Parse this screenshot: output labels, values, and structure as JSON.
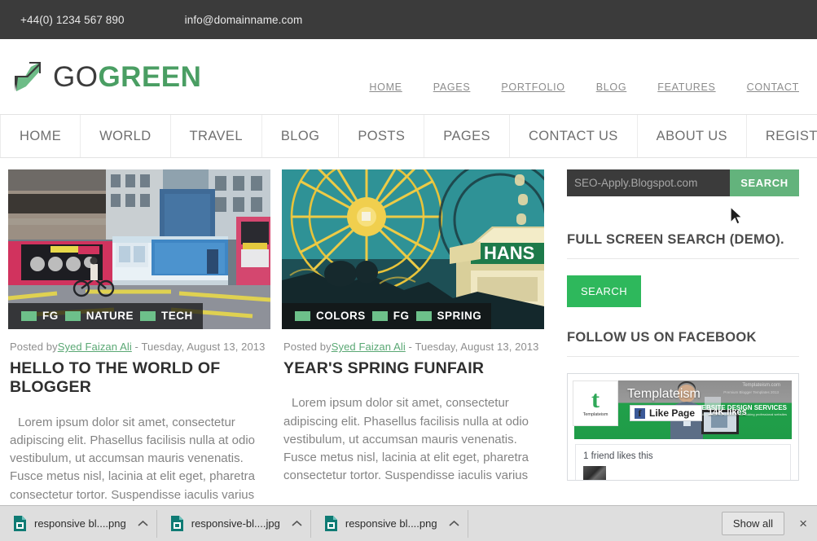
{
  "topbar": {
    "phone": "+44(0) 1234 567 890",
    "email": "info@domainname.com"
  },
  "logo": {
    "part1": "GO",
    "part2": "GREEN",
    "accent": "#4a9e63"
  },
  "topnav": {
    "items": [
      {
        "label": "HOME"
      },
      {
        "label": "PAGES"
      },
      {
        "label": "PORTFOLIO"
      },
      {
        "label": "BLOG"
      },
      {
        "label": "FEATURES"
      },
      {
        "label": "CONTACT"
      }
    ]
  },
  "mainmenu": {
    "items": [
      {
        "label": "HOME"
      },
      {
        "label": "WORLD"
      },
      {
        "label": "TRAVEL"
      },
      {
        "label": "BLOG"
      },
      {
        "label": "POSTS"
      },
      {
        "label": "PAGES"
      },
      {
        "label": "CONTACT US"
      },
      {
        "label": "ABOUT US"
      },
      {
        "label": "REGISTERS"
      }
    ]
  },
  "posts": [
    {
      "image_alt": "city-street-buses",
      "tags": [
        "FG",
        "NATURE",
        "TECH"
      ],
      "posted_by_prefix": "Posted by",
      "author": "Syed Faizan Ali",
      "date_separator": " - ",
      "date": "Tuesday, August 13, 2013",
      "title": "HELLO TO THE WORLD OF BLOGGER",
      "excerpt": "Lorem ipsum dolor sit amet, consectetur adipiscing elit. Phasellus facilisis nulla at odio vestibulum, ut accumsan mauris venenatis. Fusce metus nisl, lacinia at elit eget, pharetra consectetur tortor. Suspendisse iaculis varius"
    },
    {
      "image_alt": "ferris-wheel-funfair",
      "tags": [
        "COLORS",
        "FG",
        "SPRING"
      ],
      "posted_by_prefix": "Posted by",
      "author": "Syed Faizan Ali",
      "date_separator": " - ",
      "date": "Tuesday, August 13, 2013",
      "title": "YEAR'S SPRING FUNFAIR",
      "excerpt": "Lorem ipsum dolor sit amet, consectetur adipiscing elit. Phasellus facilisis nulla at odio vestibulum, ut accumsan mauris venenatis. Fusce metus nisl, lacinia at elit eget, pharetra consectetur tortor. Suspendisse iaculis varius"
    }
  ],
  "sidebar": {
    "search": {
      "placeholder": "SEO-Apply.Blogspot.com",
      "value": "",
      "button_label": "SEARCH",
      "button_color": "#63b37c"
    },
    "fullscreen_search": {
      "heading": "FULL SCREEN SEARCH (DEMO).",
      "button_label": "SEARCH",
      "button_color": "#2eb85c"
    },
    "facebook": {
      "heading": "FOLLOW US ON FACEBOOK",
      "page_name": "Templateism",
      "like_button": "Like Page",
      "like_count": "14K likes",
      "friends_text": "1 friend likes this",
      "avatar_mark": "t",
      "avatar_name": "Templateism",
      "cover_url": "Templateism.com",
      "cover_sub": "Premium Blogger Templates 2013",
      "cover_service": "WEBSITE DESIGN SERVICES",
      "cover_service_sub": "We provide the best and nice looking professional websites"
    }
  },
  "downloadbar": {
    "items": [
      {
        "filename": "responsive bl....png"
      },
      {
        "filename": "responsive-bl....jpg"
      },
      {
        "filename": "responsive bl....png"
      }
    ],
    "show_all": "Show all",
    "close": "×"
  }
}
